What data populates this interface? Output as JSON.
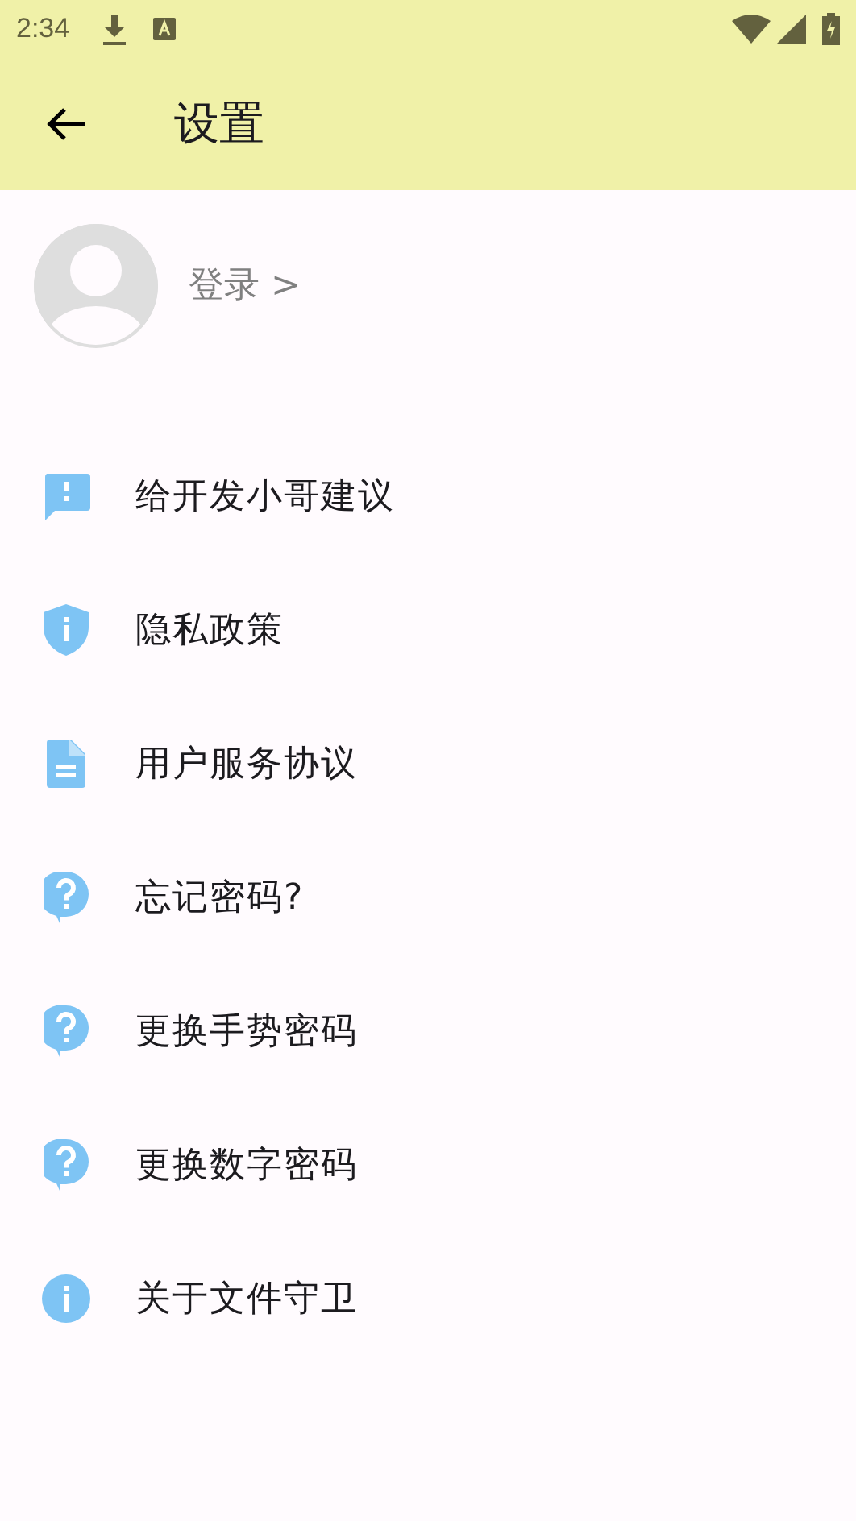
{
  "status_bar": {
    "time": "2:34"
  },
  "app_bar": {
    "title": "设置"
  },
  "profile": {
    "login": "登录 >"
  },
  "items": [
    {
      "kind": "feedback",
      "label": "给开发小哥建议"
    },
    {
      "kind": "shield",
      "label": "隐私政策"
    },
    {
      "kind": "document",
      "label": "用户服务协议"
    },
    {
      "kind": "help",
      "label": "忘记密码?"
    },
    {
      "kind": "help",
      "label": "更换手势密码"
    },
    {
      "kind": "help",
      "label": "更换数字密码"
    },
    {
      "kind": "info",
      "label": "关于文件守卫"
    }
  ]
}
